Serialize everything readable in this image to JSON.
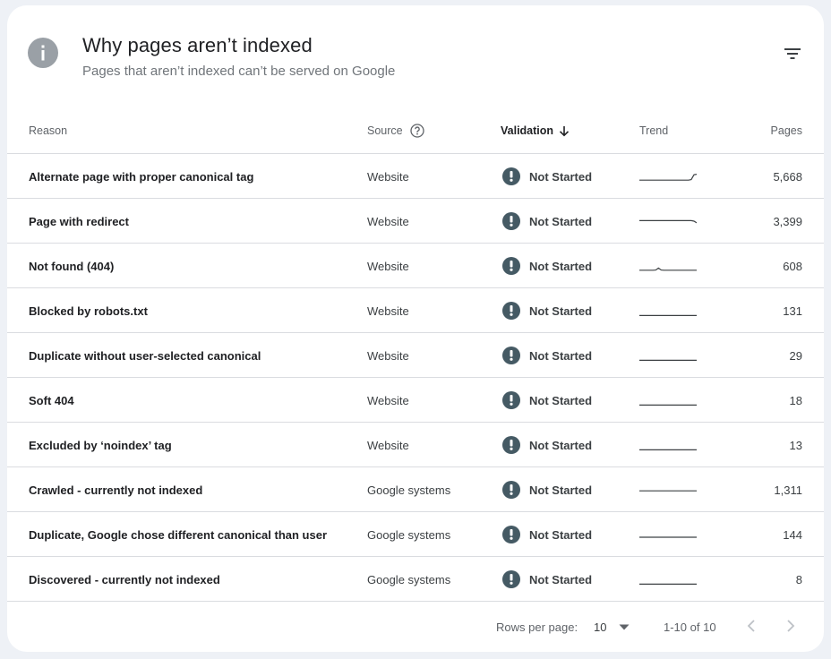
{
  "header": {
    "title": "Why pages aren’t indexed",
    "subtitle": "Pages that aren’t indexed can’t be served on Google",
    "info_icon": "info-icon",
    "filter_icon": "filter-list-icon"
  },
  "table": {
    "columns": {
      "reason": "Reason",
      "source": "Source",
      "validation": "Validation",
      "trend": "Trend",
      "pages": "Pages"
    },
    "validation_sort": "descending",
    "rows": [
      {
        "reason": "Alternate page with proper canonical tag",
        "source": "Website",
        "validation": "Not Started",
        "pages": "5,668",
        "trend": [
          0.15,
          0.15,
          0.15,
          0.15,
          0.15,
          0.15,
          0.15,
          0.15,
          0.15,
          0.15,
          0.15,
          0.15,
          0.15,
          0.15,
          0.15,
          0.15,
          0.15,
          0.15,
          0.15,
          0.2,
          0.65,
          0.7
        ]
      },
      {
        "reason": "Page with redirect",
        "source": "Website",
        "validation": "Not Started",
        "pages": "3,399",
        "trend": [
          0.55,
          0.55,
          0.55,
          0.55,
          0.55,
          0.55,
          0.55,
          0.55,
          0.55,
          0.55,
          0.55,
          0.55,
          0.55,
          0.55,
          0.55,
          0.55,
          0.55,
          0.55,
          0.55,
          0.55,
          0.5,
          0.35
        ]
      },
      {
        "reason": "Not found (404)",
        "source": "Website",
        "validation": "Not Started",
        "pages": "608",
        "trend": [
          0.1,
          0.1,
          0.1,
          0.1,
          0.1,
          0.1,
          0.12,
          0.3,
          0.12,
          0.1,
          0.1,
          0.1,
          0.1,
          0.1,
          0.1,
          0.1,
          0.1,
          0.1,
          0.1,
          0.1,
          0.1,
          0.1
        ]
      },
      {
        "reason": "Blocked by robots.txt",
        "source": "Website",
        "validation": "Not Started",
        "pages": "131",
        "trend": [
          0.05,
          0.05,
          0.05,
          0.05,
          0.05,
          0.05,
          0.05,
          0.05,
          0.05,
          0.05,
          0.05,
          0.05,
          0.05,
          0.05,
          0.05,
          0.05,
          0.05,
          0.05,
          0.05,
          0.05,
          0.05,
          0.05
        ]
      },
      {
        "reason": "Duplicate without user-selected canonical",
        "source": "Website",
        "validation": "Not Started",
        "pages": "29",
        "trend": [
          0.05,
          0.05,
          0.05,
          0.05,
          0.05,
          0.05,
          0.05,
          0.05,
          0.05,
          0.05,
          0.05,
          0.05,
          0.05,
          0.05,
          0.05,
          0.05,
          0.05,
          0.05,
          0.05,
          0.05,
          0.05,
          0.05
        ]
      },
      {
        "reason": "Soft 404",
        "source": "Website",
        "validation": "Not Started",
        "pages": "18",
        "trend": [
          0.05,
          0.05,
          0.05,
          0.05,
          0.05,
          0.05,
          0.05,
          0.05,
          0.05,
          0.05,
          0.05,
          0.05,
          0.05,
          0.05,
          0.05,
          0.05,
          0.05,
          0.05,
          0.05,
          0.05,
          0.05,
          0.05
        ]
      },
      {
        "reason": "Excluded by ‘noindex’ tag",
        "source": "Website",
        "validation": "Not Started",
        "pages": "13",
        "trend": [
          0.05,
          0.05,
          0.05,
          0.05,
          0.05,
          0.05,
          0.05,
          0.05,
          0.05,
          0.05,
          0.05,
          0.05,
          0.05,
          0.05,
          0.05,
          0.05,
          0.05,
          0.05,
          0.05,
          0.05,
          0.05,
          0.05
        ]
      },
      {
        "reason": "Crawled - currently not indexed",
        "source": "Google systems",
        "validation": "Not Started",
        "pages": "1,311",
        "trend": [
          0.4,
          0.4,
          0.4,
          0.4,
          0.4,
          0.4,
          0.4,
          0.4,
          0.4,
          0.4,
          0.4,
          0.4,
          0.4,
          0.4,
          0.4,
          0.4,
          0.4,
          0.4,
          0.4,
          0.4,
          0.4,
          0.4
        ]
      },
      {
        "reason": "Duplicate, Google chose different canonical than user",
        "source": "Google systems",
        "validation": "Not Started",
        "pages": "144",
        "trend": [
          0.25,
          0.25,
          0.25,
          0.25,
          0.25,
          0.25,
          0.25,
          0.25,
          0.25,
          0.25,
          0.25,
          0.25,
          0.25,
          0.25,
          0.25,
          0.25,
          0.25,
          0.25,
          0.25,
          0.25,
          0.25,
          0.25
        ]
      },
      {
        "reason": "Discovered - currently not indexed",
        "source": "Google systems",
        "validation": "Not Started",
        "pages": "8",
        "trend": [
          0.05,
          0.05,
          0.05,
          0.05,
          0.05,
          0.05,
          0.05,
          0.05,
          0.05,
          0.05,
          0.05,
          0.05,
          0.05,
          0.05,
          0.05,
          0.05,
          0.05,
          0.05,
          0.05,
          0.05,
          0.05,
          0.05
        ]
      }
    ]
  },
  "footer": {
    "rows_per_page_label": "Rows per page:",
    "rows_per_page_value": "10",
    "range": "1-10 of 10"
  },
  "colors": {
    "status_icon": "#455a64",
    "trend_line": "#3c4043",
    "divider": "#dadce0"
  }
}
